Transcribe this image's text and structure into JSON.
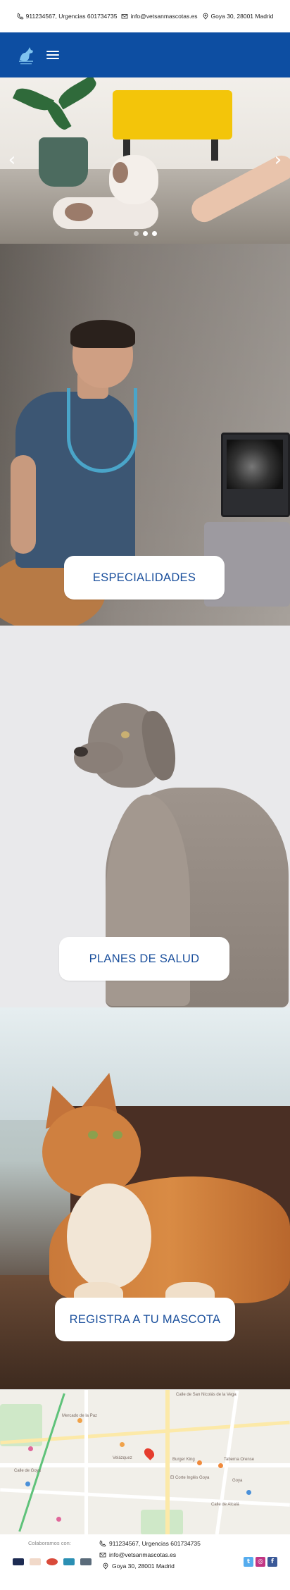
{
  "topbar": {
    "phone": "911234567, Urgencias 601734735",
    "email": "info@vetsanmascotas.es",
    "address": "Goya 30, 28001 Madrid"
  },
  "colors": {
    "header_bg": "#0d4ea2",
    "cta_text": "#1a4f9c",
    "twitter": "#55acee",
    "instagram": "#c13584",
    "facebook": "#3b5998"
  },
  "hero": {
    "prev_icon": "chevron-left-icon",
    "next_icon": "chevron-right-icon",
    "prev_glyph": "‹",
    "next_glyph": "›",
    "slides": 3,
    "active_slide": 2
  },
  "panels": [
    {
      "cta": "ESPECIALIDADES"
    },
    {
      "cta": "PLANES DE SALUD"
    },
    {
      "cta": "REGISTRA A TU MASCOTA"
    }
  ],
  "map": {
    "labels": [
      "Calle de San Nicolás de la Vega",
      "Mercado de la Paz",
      "Velázquez",
      "Burger King",
      "Taberna Orense",
      "El Corte Inglés Goya",
      "Goya",
      "Calle de Goya",
      "Calle de Alcalá"
    ]
  },
  "footer": {
    "collab_label": "Colaboramos con:",
    "phone": "911234567, Urgencias 601734735",
    "email": "info@vetsanmascotas.es",
    "address": "Goya 30, 28001 Madrid",
    "social": {
      "twitter": "t",
      "instagram": "◎",
      "facebook": "f"
    }
  }
}
